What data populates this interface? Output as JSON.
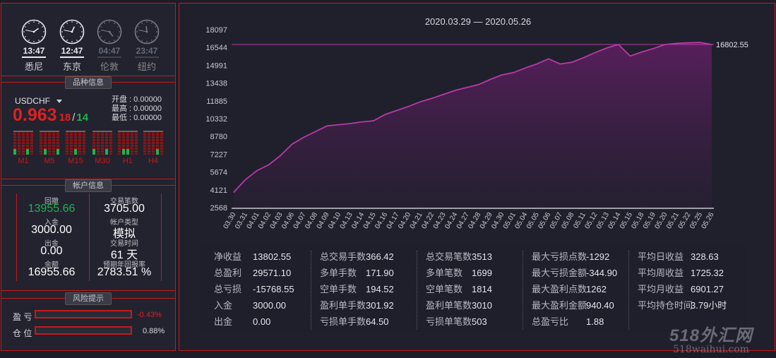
{
  "clocks": [
    {
      "time": "13:47",
      "city": "悉尼",
      "active": true
    },
    {
      "time": "12:47",
      "city": "东京",
      "active": true
    },
    {
      "time": "04:47",
      "city": "伦敦",
      "active": false
    },
    {
      "time": "23:47",
      "city": "纽约",
      "active": false
    }
  ],
  "symbol_info": {
    "header": "品种信息",
    "symbol": "USDCHF",
    "price_main": "0.963",
    "price_frac": "18",
    "slash": "/",
    "spread": "14",
    "open_label": "开盘 : 0.00000",
    "high_label": "最高 : 0.00000",
    "low_label": "最低 : 0.00000",
    "timeframes": [
      "M1",
      "M5",
      "M15",
      "M30",
      "H1",
      "H4"
    ]
  },
  "account": {
    "header": "帐户信息",
    "drawdown_label": "回撤",
    "drawdown_value": "13955.66",
    "trades_label": "交易笔数",
    "trades_value": "3705.00",
    "deposit_label": "入金",
    "deposit_value": "3000.00",
    "type_label": "帐户类型",
    "type_value": "模拟",
    "withdraw_label": "出金",
    "withdraw_value": "0.00",
    "time_label": "交易时间",
    "time_value": "61 天",
    "balance_label": "余额",
    "balance_value": "16955.66",
    "annual_label": "预期年回报率",
    "annual_value": "2783.51 %"
  },
  "risk": {
    "header": "风险提示",
    "pl_label": "盈 亏",
    "pl_value": "-0.43%",
    "pos_label": "仓 位",
    "pos_value": "0.88%"
  },
  "chart_data": {
    "type": "area",
    "title": "2020.03.29 — 2020.05.26",
    "yticks": [
      "18097",
      "16544",
      "14991",
      "13438",
      "11885",
      "10332",
      "8780",
      "7227",
      "5674",
      "4121",
      "2568"
    ],
    "ylim": [
      2568,
      18097
    ],
    "last_value_label": "16802.55",
    "last_value": 16802.55,
    "x": [
      "03.30",
      "03.31",
      "04.01",
      "04.02",
      "04.03",
      "04.06",
      "04.07",
      "04.08",
      "04.09",
      "04.10",
      "04.13",
      "04.14",
      "04.15",
      "04.16",
      "04.17",
      "04.20",
      "04.21",
      "04.22",
      "04.23",
      "04.24",
      "04.27",
      "04.28",
      "04.29",
      "04.30",
      "05.01",
      "05.04",
      "05.05",
      "05.06",
      "05.07",
      "05.08",
      "05.11",
      "05.12",
      "05.13",
      "05.14",
      "05.15",
      "05.18",
      "05.19",
      "05.20",
      "05.21",
      "05.22",
      "05.25",
      "05.26"
    ],
    "values": [
      3900,
      5000,
      5800,
      6300,
      7100,
      8100,
      8700,
      9200,
      9700,
      9800,
      9900,
      10050,
      10150,
      10700,
      11050,
      11400,
      11800,
      12100,
      12450,
      12800,
      13050,
      13300,
      13750,
      14150,
      14350,
      14750,
      15100,
      15550,
      15100,
      15250,
      15650,
      16100,
      16500,
      16800,
      15800,
      16150,
      16450,
      16800,
      16900,
      16950,
      16980,
      16802.55
    ],
    "line_color": "#b93aa8",
    "fill_color": "#5a1f5e"
  },
  "stats": {
    "col1": [
      [
        "净收益",
        "13802.55"
      ],
      [
        "总盈利",
        "29571.10"
      ],
      [
        "总亏损",
        "-15768.55"
      ],
      [
        "入金",
        "3000.00"
      ],
      [
        "出金",
        "0.00"
      ]
    ],
    "col2": [
      [
        "总交易手数",
        "366.42"
      ],
      [
        "多单手数",
        "171.90"
      ],
      [
        "空单手数",
        "194.52"
      ],
      [
        "盈利单手数",
        "301.92"
      ],
      [
        "亏损单手数",
        "64.50"
      ]
    ],
    "col3": [
      [
        "总交易笔数",
        "3513"
      ],
      [
        "多单笔数",
        "1699"
      ],
      [
        "空单笔数",
        "1814"
      ],
      [
        "盈利单笔数",
        "3010"
      ],
      [
        "亏损单笔数",
        "503"
      ]
    ],
    "col4": [
      [
        "最大亏损点数",
        "-1292"
      ],
      [
        "最大亏损金额",
        "-344.90"
      ],
      [
        "最大盈利点数",
        "1262"
      ],
      [
        "最大盈利金额",
        "940.40"
      ],
      [
        "总盈亏比",
        "1.88"
      ]
    ],
    "col5": [
      [
        "平均日收益",
        "328.63"
      ],
      [
        "平均周收益",
        "1725.32"
      ],
      [
        "平均月收益",
        "6901.27"
      ],
      [
        "平均持仓时间",
        "3.79小时"
      ]
    ]
  },
  "watermark": {
    "line1": "518外汇网",
    "line2": "518waihui.com"
  },
  "colors": {
    "border": "#c41a1a",
    "up": "#22b14c",
    "down": "#e02020"
  }
}
